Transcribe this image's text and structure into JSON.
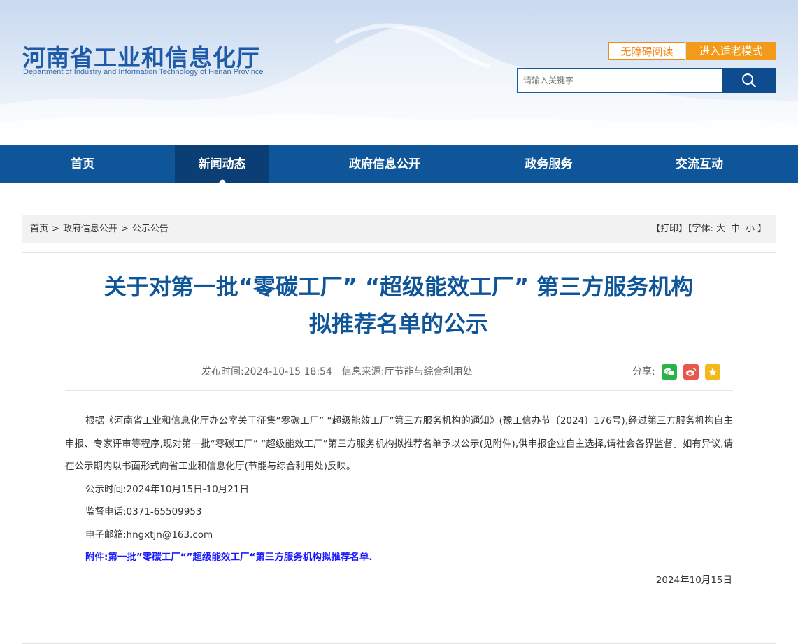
{
  "header": {
    "title": "河南省工业和信息化厅",
    "subtitle": "Department of Industry and Information Technology of Henan Province",
    "accessibility_label": "无障碍阅读",
    "elder_mode_label": "进入适老模式",
    "search_placeholder": "请输入关键字",
    "search_icon": "search-icon"
  },
  "nav": {
    "items": [
      {
        "label": "首页"
      },
      {
        "label": "新闻动态",
        "active": true
      },
      {
        "label": "政府信息公开"
      },
      {
        "label": "政务服务"
      },
      {
        "label": "交流互动"
      }
    ]
  },
  "breadcrumb": {
    "items": [
      "首页",
      "政府信息公开",
      "公示公告"
    ],
    "separator": ">"
  },
  "tools": {
    "print_label": "【打印】",
    "font_label": "【字体:",
    "font_large": "大",
    "font_medium": "中",
    "font_small": "小",
    "font_close": "】"
  },
  "article": {
    "title_line1": "关于对第一批“零碳工厂” “超级能效工厂” 第三方服务机构",
    "title_line2": "拟推荐名单的公示",
    "publish_time": "发布时间:2024-10-15 18:54",
    "source": "信息来源:厅节能与综合利用处",
    "share_label": "分享:",
    "share_icons": [
      "wechat-icon",
      "weibo-icon",
      "favorite-icon"
    ],
    "paragraph": "根据《河南省工业和信息化厅办公室关于征集“零碳工厂” “超级能效工厂”第三方服务机构的通知》(豫工信办节〔2024〕176号),经过第三方服务机构自主申报、专家评审等程序,现对第一批“零碳工厂” “超级能效工厂”第三方服务机构拟推荐名单予以公示(见附件),供申报企业自主选择,请社会各界监督。如有异议,请在公示期内以书面形式向省工业和信息化厅(节能与综合利用处)反映。",
    "notice_period": "公示时间:2024年10月15日-10月21日",
    "phone": "监督电话:0371-65509953",
    "email": "电子邮箱:hngxtjn@163.com",
    "attachment": "附件:第一批”零碳工厂“”超级能效工厂“第三方服务机构拟推荐名单.",
    "date": "2024年10月15日"
  },
  "colors": {
    "brand_blue": "#0e5599",
    "nav_active": "#0b3e74",
    "orange": "#f49a1a",
    "link_blue": "#1a1aff"
  }
}
